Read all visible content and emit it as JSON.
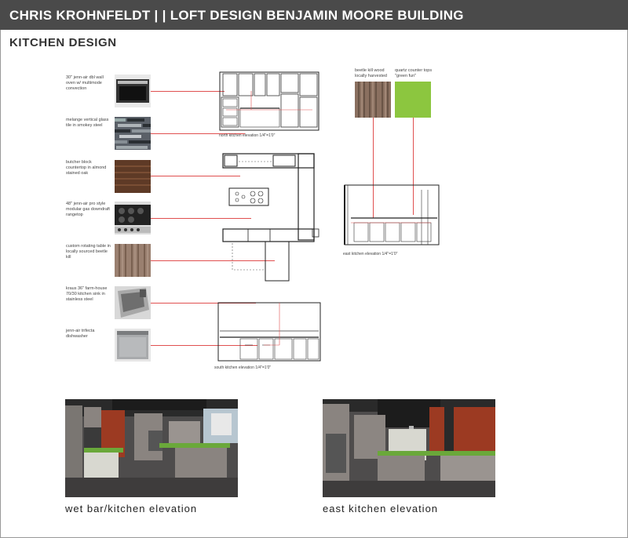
{
  "header": {
    "title": "CHRIS KROHNFELDT | | LOFT DESIGN BENJAMIN MOORE BUILDING"
  },
  "section": {
    "title": "KITCHEN DESIGN"
  },
  "specs": [
    {
      "text": "30\" jenn-air dbl wall oven w/ multimode convection",
      "icon": "wall-oven-photo"
    },
    {
      "text": "melange vertical glass tile in smokey steel",
      "icon": "glass-tile-photo"
    },
    {
      "text": "butcher block countertop in almond stained oak",
      "icon": "butcher-block-photo"
    },
    {
      "text": "48\" jenn-air pro style modular gas downdraft rangetop",
      "icon": "rangetop-photo"
    },
    {
      "text": "custom rotating table in locally sourced beetle kill",
      "icon": "beetle-kill-table-photo"
    },
    {
      "text": "kraus 36\" farm-house 70/30 kitchen sink in stainless steel",
      "icon": "farmhouse-sink-photo"
    },
    {
      "text": "jenn-air trifecta dishwasher",
      "icon": "dishwasher-photo"
    }
  ],
  "materials": [
    {
      "text": "beetle kill wood locally harvested",
      "color": "#8a7060"
    },
    {
      "text": "quartz counter tops \"green fun\"",
      "color": "#8cc63f"
    }
  ],
  "elevations": {
    "north": "north kitchen elevation 1/4\"=1'0\"",
    "east": "east kitchen elevation 1/4\"=1'0\"",
    "south": "south kitchen elevation 1/4\"=1'0\""
  },
  "renders": [
    {
      "caption": "wet bar/kitchen elevation"
    },
    {
      "caption": "east kitchen elevation"
    }
  ],
  "colors": {
    "header_bg": "#4a4a4a",
    "leader": "#e05050",
    "green_quartz": "#8cc63f"
  }
}
